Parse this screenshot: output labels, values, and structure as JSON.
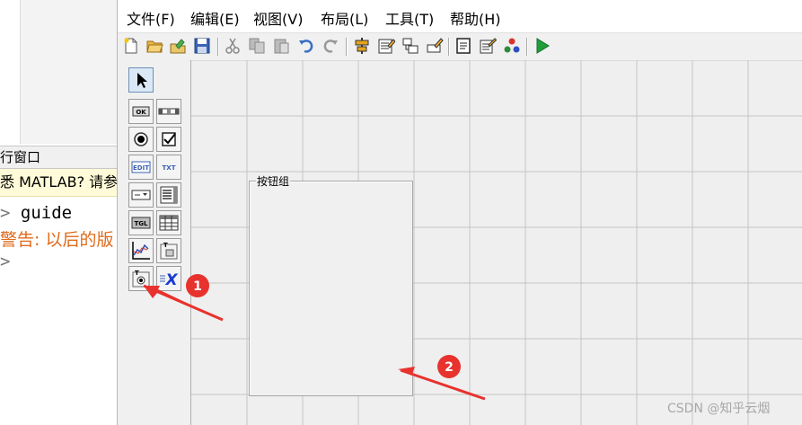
{
  "command_window": {
    "title": "行窗口",
    "notice": "悉 MATLAB? 请参",
    "lines": [
      {
        "prompt": ">",
        "text": " guide"
      },
      {
        "text": "警告: 以后的版"
      },
      {
        "prompt": ">",
        "text": ""
      }
    ]
  },
  "menubar": {
    "file": "文件(F)",
    "edit": "编辑(E)",
    "view": "视图(V)",
    "layout": "布局(L)",
    "tools": "工具(T)",
    "help": "帮助(H)"
  },
  "toolbar": {
    "icons": [
      "new-icon",
      "open-icon",
      "export-icon",
      "save-icon",
      "cut-icon",
      "copy-icon",
      "paste-icon",
      "undo-icon",
      "redo-icon",
      "align-icon",
      "menu-editor-icon",
      "tab-order-icon",
      "toolbar-editor-icon",
      "editor-icon",
      "property-inspector-icon",
      "object-browser-icon",
      "run-icon"
    ]
  },
  "palette": {
    "items": [
      {
        "name": "select-tool",
        "label": ""
      },
      {
        "name": "push-button-tool",
        "label": "OK"
      },
      {
        "name": "slider-tool",
        "label": ""
      },
      {
        "name": "radio-button-tool",
        "label": ""
      },
      {
        "name": "checkbox-tool",
        "label": ""
      },
      {
        "name": "edit-text-tool",
        "label": "EDIT"
      },
      {
        "name": "static-text-tool",
        "label": "TXT"
      },
      {
        "name": "popup-menu-tool",
        "label": ""
      },
      {
        "name": "listbox-tool",
        "label": ""
      },
      {
        "name": "toggle-button-tool",
        "label": "TGL"
      },
      {
        "name": "table-tool",
        "label": ""
      },
      {
        "name": "axes-tool",
        "label": ""
      },
      {
        "name": "panel-tool",
        "label": "T"
      },
      {
        "name": "button-group-tool",
        "label": "T"
      },
      {
        "name": "activex-tool",
        "label": "X"
      }
    ]
  },
  "canvas": {
    "button_group_label": "按钮组"
  },
  "annotations": {
    "marker_1": "1",
    "marker_2": "2",
    "marker_color": "#e8322d"
  },
  "watermark": "CSDN @知乎云烟"
}
